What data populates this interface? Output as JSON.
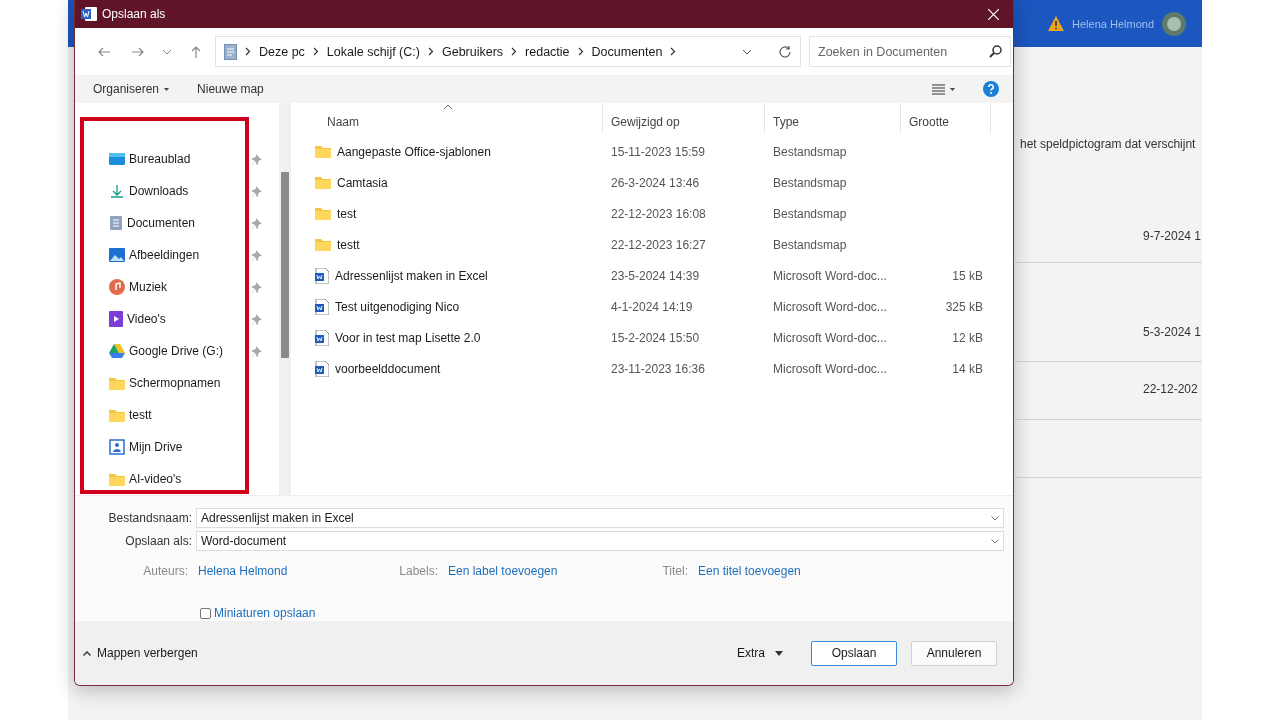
{
  "background": {
    "user": "Helena Helmond",
    "note": "het speldpictogram dat verschijnt",
    "dates": [
      "9-7-2024 1",
      "5-3-2024 1",
      "22-12-202"
    ]
  },
  "window": {
    "title": "Opslaan als"
  },
  "address": {
    "path": [
      "Deze pc",
      "Lokale schijf (C:)",
      "Gebruikers",
      "redactie",
      "Documenten"
    ]
  },
  "search": {
    "placeholder": "Zoeken in Documenten"
  },
  "toolbar": {
    "items": [
      {
        "label": "Organiseren",
        "menu": true
      },
      {
        "label": "Nieuwe map",
        "menu": false
      }
    ]
  },
  "nav": {
    "items": [
      {
        "label": "Bureaublad",
        "kind": "desktop",
        "pinned": true
      },
      {
        "label": "Downloads",
        "kind": "download",
        "pinned": true
      },
      {
        "label": "Documenten",
        "kind": "document",
        "pinned": true
      },
      {
        "label": "Afbeeldingen",
        "kind": "pictures",
        "pinned": true
      },
      {
        "label": "Muziek",
        "kind": "music",
        "pinned": true
      },
      {
        "label": "Video's",
        "kind": "video",
        "pinned": true
      },
      {
        "label": "Google Drive (G:)",
        "kind": "drive",
        "pinned": true
      },
      {
        "label": "Schermopnamen",
        "kind": "folder",
        "pinned": false
      },
      {
        "label": "testt",
        "kind": "folder",
        "pinned": false
      },
      {
        "label": "Mijn Drive",
        "kind": "mydrive",
        "pinned": false
      },
      {
        "label": "AI-video's",
        "kind": "folder",
        "pinned": false
      }
    ]
  },
  "file_list": {
    "columns": [
      {
        "label": "Naam",
        "sorted": true
      },
      {
        "label": "Gewijzigd op",
        "sorted": false
      },
      {
        "label": "Type",
        "sorted": false
      },
      {
        "label": "Grootte",
        "sorted": false
      }
    ],
    "rows": [
      {
        "name": "Aangepaste Office-sjablonen",
        "modified": "15-11-2023 15:59",
        "type": "Bestandsmap",
        "size": "",
        "kind": "folder"
      },
      {
        "name": "Camtasia",
        "modified": "26-3-2024 13:46",
        "type": "Bestandsmap",
        "size": "",
        "kind": "folder"
      },
      {
        "name": "test",
        "modified": "22-12-2023 16:08",
        "type": "Bestandsmap",
        "size": "",
        "kind": "folder"
      },
      {
        "name": "testt",
        "modified": "22-12-2023 16:27",
        "type": "Bestandsmap",
        "size": "",
        "kind": "folder"
      },
      {
        "name": "Adressenlijst maken in Excel",
        "modified": "23-5-2024 14:39",
        "type": "Microsoft Word-doc...",
        "size": "15 kB",
        "kind": "word"
      },
      {
        "name": "Test uitgenodiging Nico",
        "modified": "4-1-2024 14:19",
        "type": "Microsoft Word-doc...",
        "size": "325 kB",
        "kind": "word"
      },
      {
        "name": "Voor in test map Lisette 2.0",
        "modified": "15-2-2024 15:50",
        "type": "Microsoft Word-doc...",
        "size": "12 kB",
        "kind": "word"
      },
      {
        "name": "voorbeelddocument",
        "modified": "23-11-2023 16:36",
        "type": "Microsoft Word-doc...",
        "size": "14 kB",
        "kind": "word"
      }
    ]
  },
  "form": {
    "fields": [
      {
        "label": "Bestandsnaam:",
        "value": "Adressenlijst maken in Excel"
      },
      {
        "label": "Opslaan als:",
        "value": "Word-document"
      }
    ],
    "meta": [
      {
        "label": "Auteurs:",
        "link": "Helena Helmond"
      },
      {
        "label": "Labels:",
        "link": "Een label toevoegen"
      },
      {
        "label": "Titel:",
        "link": "Een titel toevoegen"
      }
    ],
    "checkbox": {
      "label": "Miniaturen opslaan",
      "checked": false
    }
  },
  "footer": {
    "toggle": "Mappen verbergen",
    "extra": "Extra",
    "buttons": [
      {
        "label": "Opslaan",
        "default": true
      },
      {
        "label": "Annuleren",
        "default": false
      }
    ]
  }
}
